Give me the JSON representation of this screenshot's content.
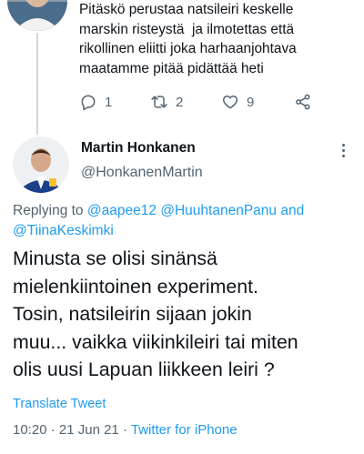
{
  "parent_tweet": {
    "text_lines": [
      "Pitäskö perustaa natsileiri keskelle",
      "marskin risteystä  ja ilmotettas että",
      "rikollinen eliitti joka harhaanjohtava",
      "maatamme pitää pidättää heti"
    ],
    "actions": {
      "reply_count": "1",
      "retweet_count": "2",
      "like_count": "9"
    }
  },
  "tweet": {
    "display_name": "Martin Honkanen",
    "handle": "@HonkanenMartin",
    "replying_to_prefix": "Replying to ",
    "mentions": [
      "@aapee12",
      "@HuuhtanenPanu",
      "@TiinaKeskimki"
    ],
    "mention_conjunction": " and",
    "body_lines": [
      "Minusta se olisi sinänsä",
      "mielenkiintoinen experiment.",
      "Tosin, natsileirin sijaan jokin",
      "muu... vaikka viikinkileiri tai miten",
      "olis uusi Lapuan liikkeen leiri ?"
    ],
    "translate_label": "Translate Tweet",
    "time": "10:20",
    "date": "21 Jun 21",
    "separator": " · ",
    "source": "Twitter for iPhone"
  },
  "colors": {
    "link": "#1d9bf0",
    "secondary_text": "#536471",
    "primary_text": "#0f1419",
    "thread_line": "#cfd9de"
  },
  "icons": {
    "reply": "comment-icon",
    "retweet": "retweet-icon",
    "like": "heart-icon",
    "share": "share-icon",
    "more": "more-vertical-icon"
  }
}
